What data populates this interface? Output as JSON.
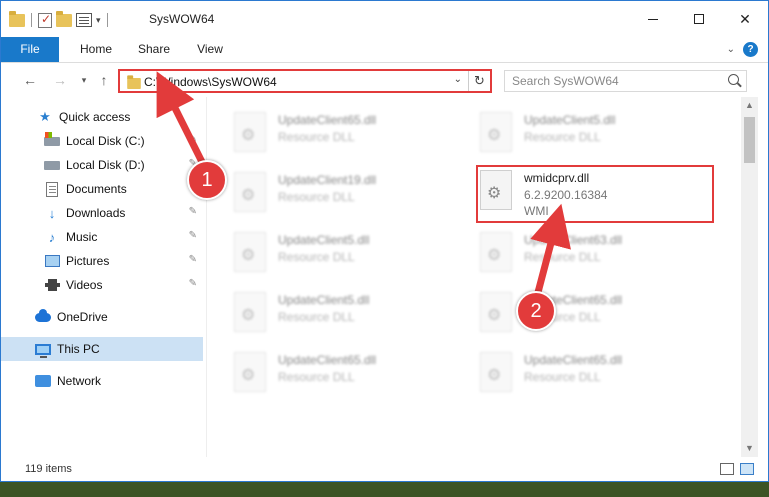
{
  "window": {
    "title": "SysWOW64"
  },
  "ribbon": {
    "tabs": [
      "File",
      "Home",
      "Share",
      "View"
    ]
  },
  "navbar": {
    "address": "C:\\Windows\\SysWOW64",
    "search_placeholder": "Search SysWOW64"
  },
  "sidebar": {
    "items": [
      {
        "label": "Quick access",
        "icon": "star-icon",
        "pinned": false
      },
      {
        "label": "Local Disk (C:)",
        "icon": "disk-icon",
        "pinned": true
      },
      {
        "label": "Local Disk (D:)",
        "icon": "disk-icon",
        "pinned": true
      },
      {
        "label": "Documents",
        "icon": "documents-icon",
        "pinned": true
      },
      {
        "label": "Downloads",
        "icon": "downloads-icon",
        "pinned": true
      },
      {
        "label": "Music",
        "icon": "music-icon",
        "pinned": true
      },
      {
        "label": "Pictures",
        "icon": "pictures-icon",
        "pinned": true
      },
      {
        "label": "Videos",
        "icon": "videos-icon",
        "pinned": true
      },
      {
        "label": "OneDrive",
        "icon": "onedrive-icon",
        "pinned": false
      },
      {
        "label": "This PC",
        "icon": "this-pc-icon",
        "selected": true
      },
      {
        "label": "Network",
        "icon": "network-icon",
        "pinned": false
      }
    ]
  },
  "files": [
    {
      "name": "UpdateClient65.dll",
      "desc": "Resource DLL",
      "blurred": true
    },
    {
      "name": "UpdateClient5.dll",
      "desc": "Resource DLL",
      "blurred": true
    },
    {
      "name": "UpdateClient19.dll",
      "desc": "Resource DLL",
      "blurred": true
    },
    {
      "name": "wmidcprv.dll",
      "version": "6.2.9200.16384",
      "desc": "WMI",
      "blurred": false,
      "highlighted": true
    },
    {
      "name": "UpdateClient5.dll",
      "desc": "Resource DLL",
      "blurred": true
    },
    {
      "name": "UpdateClient63.dll",
      "desc": "Resource DLL",
      "blurred": true
    },
    {
      "name": "UpdateClient5.dll",
      "desc": "Resource DLL",
      "blurred": true
    },
    {
      "name": "UpdateClient65.dll",
      "desc": "Resource DLL",
      "blurred": true
    },
    {
      "name": "UpdateClient65.dll",
      "desc": "Resource DLL",
      "blurred": true
    },
    {
      "name": "UpdateClient65.dll",
      "desc": "Resource DLL",
      "blurred": true
    }
  ],
  "status": {
    "items_count": "119 items"
  },
  "annotations": {
    "step1": "1",
    "step2": "2",
    "color": "#e23b3b"
  }
}
